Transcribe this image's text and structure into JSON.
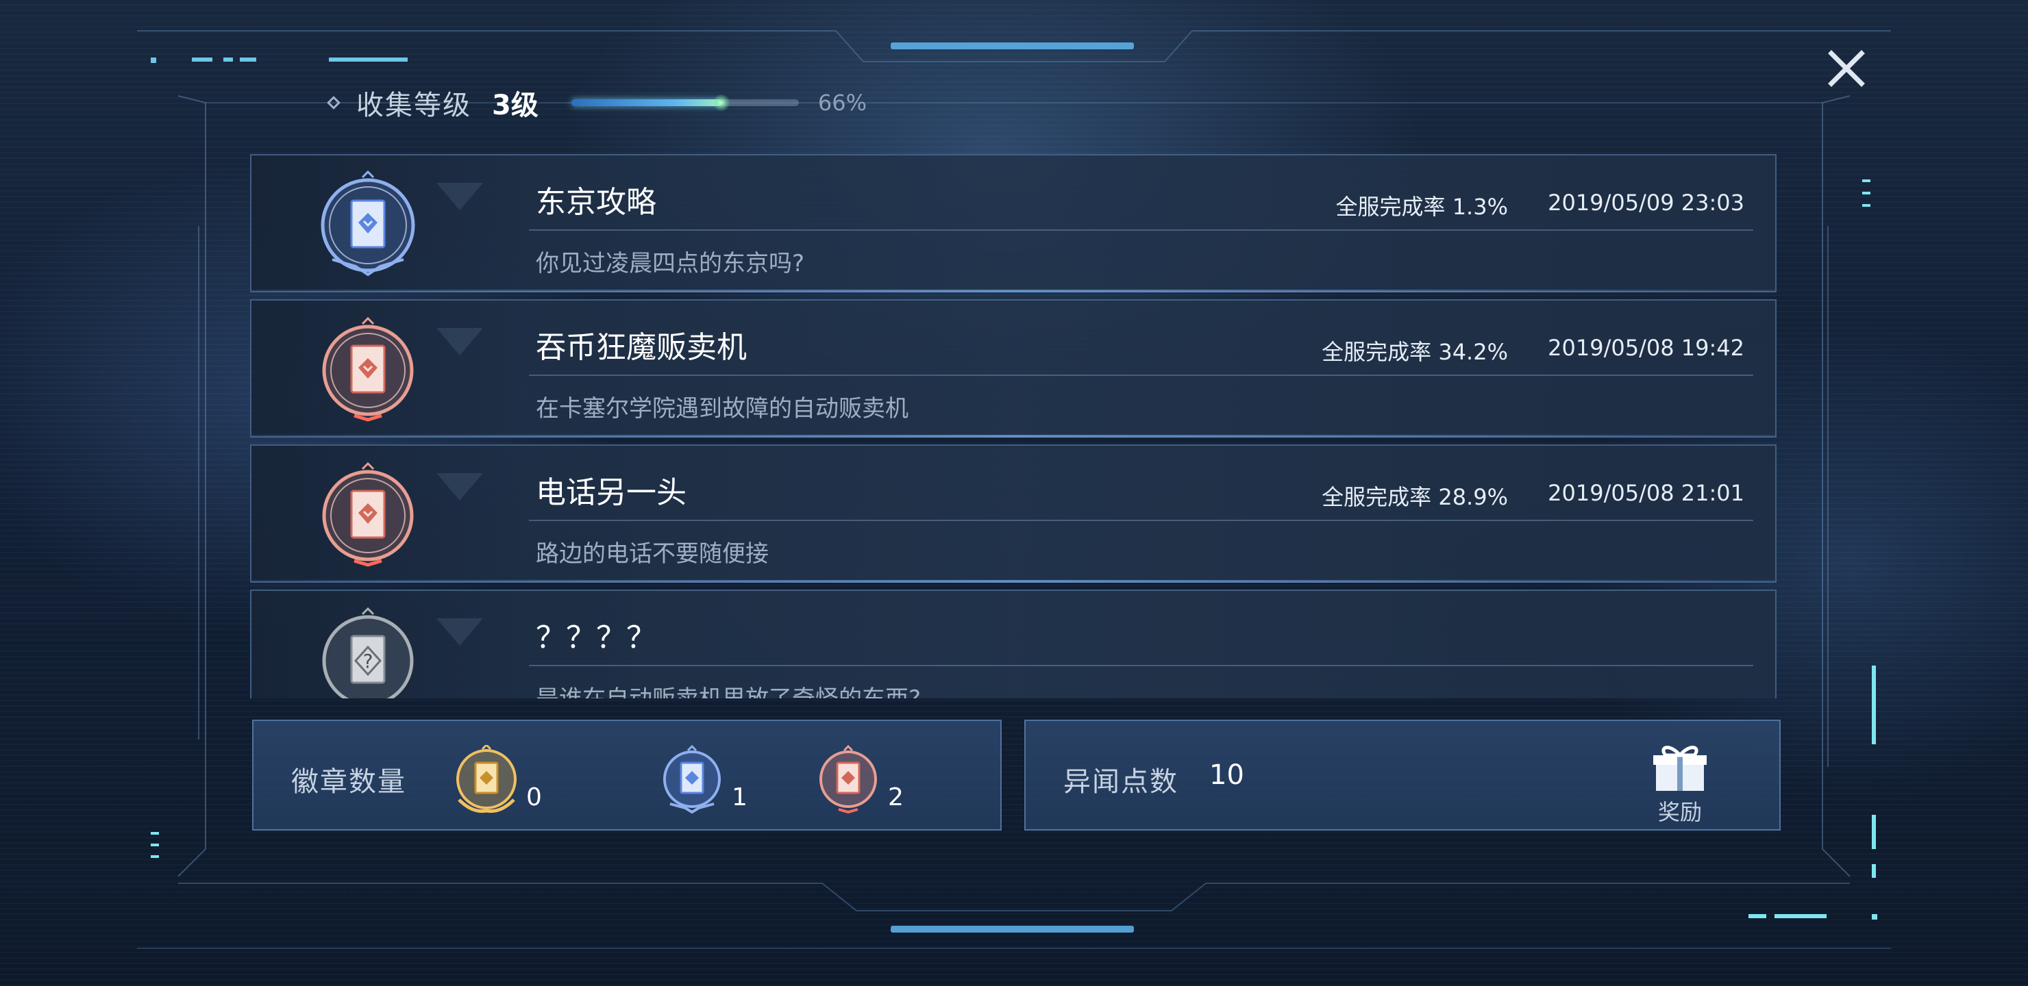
{
  "header": {
    "level_label": "收集等级",
    "level_value": "3级",
    "progress": 0.66,
    "progress_text": "66%"
  },
  "cards": [
    {
      "title": "东京攻略",
      "rate": "全服完成率 1.3%",
      "date": "2019/05/09 23:03",
      "description": "你见过凌晨四点的东京吗?",
      "badge": "blue-badge-icon"
    },
    {
      "title": "吞币狂魔贩卖机",
      "rate": "全服完成率 34.2%",
      "date": "2019/05/08 19:42",
      "description": "在卡塞尔学院遇到故障的自动贩卖机",
      "badge": "red-badge-icon"
    },
    {
      "title": "电话另一头",
      "rate": "全服完成率 28.9%",
      "date": "2019/05/08 21:01",
      "description": "路边的电话不要随便接",
      "badge": "red-badge-icon"
    },
    {
      "title": "？？？？",
      "rate": "",
      "date": "",
      "description": "是谁在自动贩卖机里放了奇怪的东西?",
      "badge": "locked-badge-icon"
    }
  ],
  "badges_panel": {
    "label": "徽章数量",
    "gold_count": "0",
    "blue_count": "1",
    "red_count": "2"
  },
  "points_panel": {
    "label": "异闻点数",
    "value": "10",
    "reward_label": "奖励",
    "reward_icon": "gift-icon"
  },
  "colors": {
    "accent": "#5fb6f0",
    "cyan_glow": "#7fe6f0",
    "blue_badge": "#5a86e0",
    "red_badge": "#e08478",
    "gold_badge": "#e8b24a",
    "locked_badge": "#9aa0a8"
  },
  "icons": {
    "close": "close-icon",
    "level": "diamond-icon"
  }
}
